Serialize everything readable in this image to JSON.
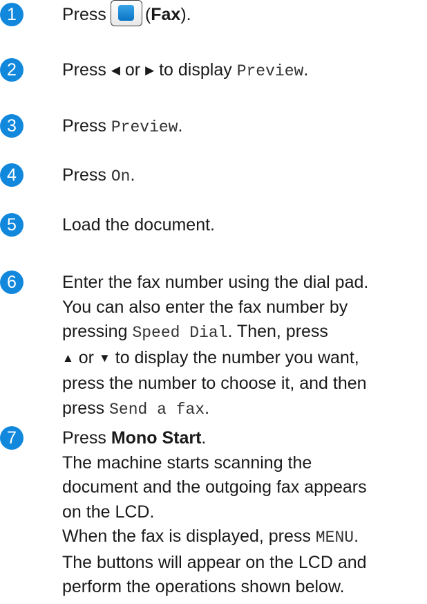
{
  "accent_color": "#1288dd",
  "steps": [
    {
      "number": "1",
      "press": "Press",
      "fax_icon": "fax-button-icon",
      "paren_open": "(",
      "fax_label": "Fax",
      "paren_close": ")."
    },
    {
      "number": "2",
      "text_a": "Press",
      "left_arrow": "◀",
      "or": "or",
      "right_arrow": "▶",
      "text_b": "to display",
      "preview": "Preview",
      "end": "."
    },
    {
      "number": "3",
      "text_a": "Press",
      "preview": "Preview",
      "end": "."
    },
    {
      "number": "4",
      "text_a": "Press",
      "on": "On",
      "end": "."
    },
    {
      "number": "5",
      "text": "Load the document."
    },
    {
      "number": "6",
      "line1": "Enter the fax number using the dial pad.",
      "line2": "You can also enter the fax number by",
      "line3_a": "pressing",
      "speed_dial": "Speed Dial",
      "line3_b": ". Then, press",
      "up_arrow": "▲",
      "or": "or",
      "down_arrow": "▼",
      "line4_b": "to display the number you want,",
      "line5": "press the number to choose it, and then",
      "line6_a": "press",
      "send_fax": "Send a fax",
      "line6_b": "."
    },
    {
      "number": "7",
      "line1_a": "Press",
      "mono_start": "Mono Start",
      "line1_b": ".",
      "line2": "The machine starts scanning the",
      "line3": "document and the outgoing fax appears",
      "line4": "on the LCD.",
      "line5_a": "When the fax is displayed, press",
      "menu": "MENU",
      "line5_b": ".",
      "line6": "The buttons will appear on the LCD and",
      "line7": "perform the operations shown below."
    }
  ]
}
